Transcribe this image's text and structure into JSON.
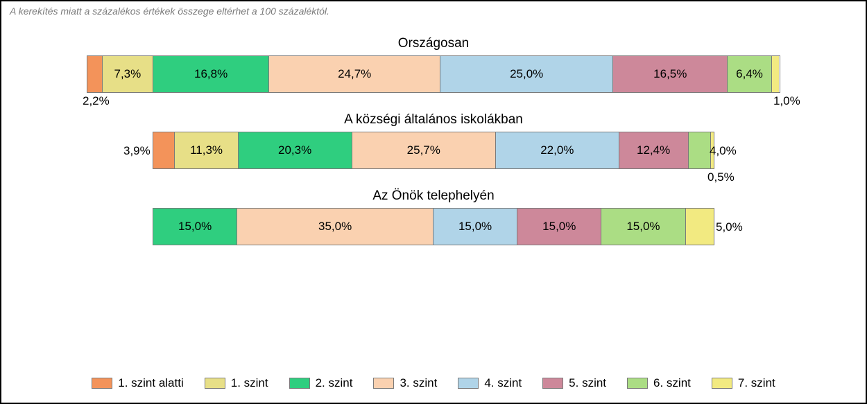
{
  "note": "A kerekítés miatt a százalékos értékek összege eltérhet a 100 százaléktól.",
  "legend": [
    {
      "label": "1. szint alatti"
    },
    {
      "label": "1. szint"
    },
    {
      "label": "2. szint"
    },
    {
      "label": "3. szint"
    },
    {
      "label": "4. szint"
    },
    {
      "label": "5. szint"
    },
    {
      "label": "6. szint"
    },
    {
      "label": "7. szint"
    }
  ],
  "rows": [
    {
      "title": "Országosan",
      "segments": [
        {
          "label": "2,2%",
          "external": "below-left"
        },
        {
          "label": "7,3%"
        },
        {
          "label": "16,8%"
        },
        {
          "label": "24,7%"
        },
        {
          "label": "25,0%"
        },
        {
          "label": "16,5%"
        },
        {
          "label": "6,4%"
        },
        {
          "label": "1,0%",
          "external": "below-right"
        }
      ]
    },
    {
      "title": "A községi általános iskolákban",
      "segments": [
        {
          "label": "3,9%",
          "external": "left"
        },
        {
          "label": "11,3%"
        },
        {
          "label": "20,3%"
        },
        {
          "label": "25,7%"
        },
        {
          "label": "22,0%"
        },
        {
          "label": "12,4%"
        },
        {
          "label": "4,0%",
          "external": "right"
        },
        {
          "label": "0,5%",
          "external": "below-right"
        }
      ]
    },
    {
      "title": "Az Önök telephelyén",
      "segments": [
        {
          "label": ""
        },
        {
          "label": ""
        },
        {
          "label": "15,0%"
        },
        {
          "label": "35,0%"
        },
        {
          "label": "15,0%"
        },
        {
          "label": "15,0%"
        },
        {
          "label": "15,0%"
        },
        {
          "label": "5,0%",
          "external": "right"
        }
      ]
    }
  ],
  "chart_data": {
    "type": "bar",
    "title": "",
    "subtitle": "A kerekítés miatt a százalékos értékek összege eltérhet a 100 százaléktól.",
    "xlabel": "",
    "ylabel": "",
    "stacked": true,
    "categories": [
      "Országosan",
      "A községi általános iskolákban",
      "Az Önök telephelyén"
    ],
    "series": [
      {
        "name": "1. szint alatti",
        "values": [
          2.2,
          3.9,
          0.0
        ],
        "color": "#f3935a"
      },
      {
        "name": "1. szint",
        "values": [
          7.3,
          11.3,
          0.0
        ],
        "color": "#e7df87"
      },
      {
        "name": "2. szint",
        "values": [
          16.8,
          20.3,
          15.0
        ],
        "color": "#2fce7f"
      },
      {
        "name": "3. szint",
        "values": [
          24.7,
          25.7,
          35.0
        ],
        "color": "#fad1b0"
      },
      {
        "name": "4. szint",
        "values": [
          25.0,
          22.0,
          15.0
        ],
        "color": "#b0d4e8"
      },
      {
        "name": "5. szint",
        "values": [
          16.5,
          12.4,
          15.0
        ],
        "color": "#cd889a"
      },
      {
        "name": "6. szint",
        "values": [
          6.4,
          4.0,
          15.0
        ],
        "color": "#abdd84"
      },
      {
        "name": "7. szint",
        "values": [
          1.0,
          0.5,
          5.0
        ],
        "color": "#f2ea81"
      }
    ],
    "ylim": [
      0,
      100
    ]
  }
}
